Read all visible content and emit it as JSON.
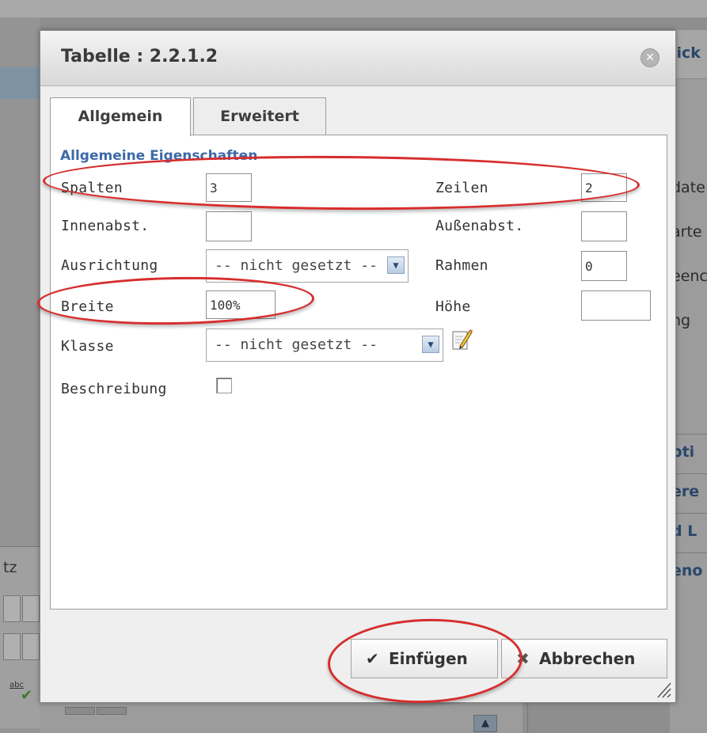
{
  "dialog": {
    "title": "Tabelle : 2.2.1.2",
    "close_icon": "close-icon",
    "tabs": [
      {
        "label": "Allgemein",
        "active": true
      },
      {
        "label": "Erweitert",
        "active": false
      }
    ],
    "legend": "Allgemeine Eigenschaften",
    "fields": {
      "spalten": {
        "label": "Spalten",
        "value": "3"
      },
      "zeilen": {
        "label": "Zeilen",
        "value": "2"
      },
      "innenabst": {
        "label": "Innenabst.",
        "value": ""
      },
      "aussenabst": {
        "label": "Außenabst.",
        "value": ""
      },
      "ausrichtung": {
        "label": "Ausrichtung",
        "value": "-- nicht gesetzt --"
      },
      "rahmen": {
        "label": "Rahmen",
        "value": "0"
      },
      "breite": {
        "label": "Breite",
        "value": "100%"
      },
      "hoehe": {
        "label": "Höhe",
        "value": ""
      },
      "klasse": {
        "label": "Klasse",
        "value": "-- nicht gesetzt --"
      },
      "beschreibung": {
        "label": "Beschreibung",
        "checked": false
      }
    },
    "buttons": {
      "insert": {
        "label": "Einfügen",
        "icon": "check-icon"
      },
      "cancel": {
        "label": "Abbrechen",
        "icon": "x-icon"
      }
    }
  },
  "background": {
    "left_text": "tz",
    "abc_label": "abc",
    "right_texts": [
      "lick",
      "date",
      "arte",
      "eenc",
      "ng",
      "pti",
      "ere",
      "d L",
      "eno"
    ]
  },
  "colors": {
    "legend": "#3d6aa8",
    "annotation": "#d72d2d"
  }
}
